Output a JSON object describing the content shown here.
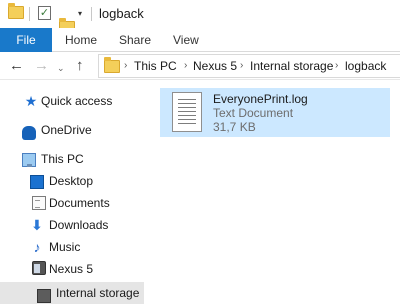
{
  "window": {
    "title": "logback"
  },
  "ribbon": {
    "tabs": [
      {
        "label": "File",
        "active": true
      },
      {
        "label": "Home"
      },
      {
        "label": "Share"
      },
      {
        "label": "View"
      }
    ]
  },
  "address_bar": {
    "breadcrumb": [
      "This PC",
      "Nexus 5",
      "Internal storage",
      "logback"
    ]
  },
  "nav_pane": {
    "items": [
      {
        "label": "Quick access",
        "icon": "star-icon"
      },
      {
        "label": "OneDrive",
        "icon": "cloud-icon"
      },
      {
        "label": "This PC",
        "icon": "computer-icon"
      },
      {
        "label": "Desktop",
        "icon": "desktop-icon"
      },
      {
        "label": "Documents",
        "icon": "documents-icon"
      },
      {
        "label": "Downloads",
        "icon": "downloads-icon"
      },
      {
        "label": "Music",
        "icon": "music-icon"
      },
      {
        "label": "Nexus 5",
        "icon": "phone-icon"
      },
      {
        "label": "Internal storage",
        "icon": "drive-icon",
        "selected": true
      }
    ]
  },
  "files": [
    {
      "name": "EveryonePrint.log",
      "type": "Text Document",
      "size": "31,7 KB",
      "icon": "text-document-icon",
      "selected": true
    }
  ],
  "colors": {
    "file_tab": "#1979ca",
    "selection": "#cce8ff",
    "nav_selected": "#e5e5e5"
  }
}
